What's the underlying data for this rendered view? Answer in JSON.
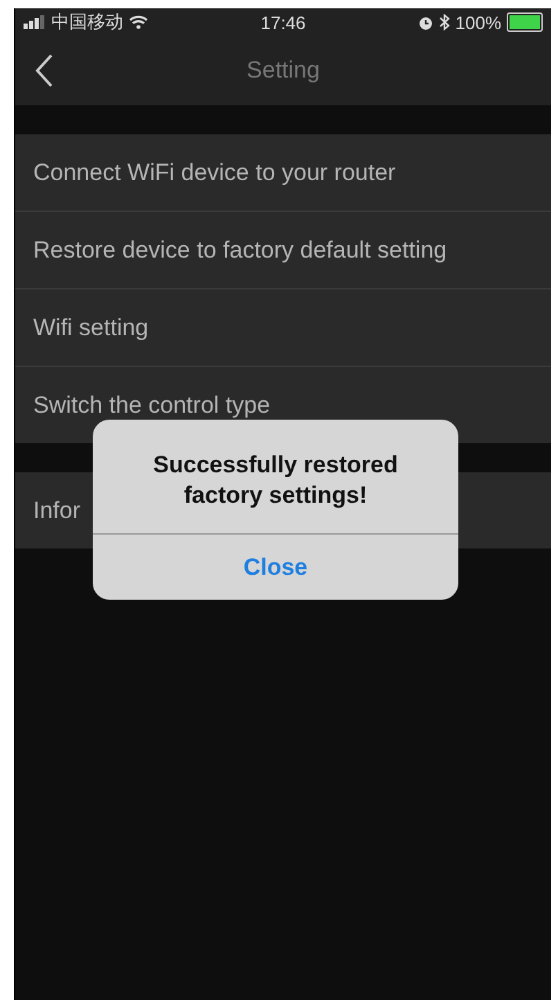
{
  "status_bar": {
    "carrier": "中国移动",
    "time": "17:46",
    "battery_text": "100%",
    "battery": {
      "level": 1.0
    }
  },
  "nav": {
    "title": "Setting"
  },
  "sections": [
    {
      "items": [
        "Connect WiFi device to your router",
        "Restore device to factory default setting",
        "Wifi setting",
        "Switch the control type"
      ]
    },
    {
      "items": [
        "Infor"
      ]
    }
  ],
  "dialog": {
    "message": "Successfully restored factory settings!",
    "button": "Close"
  }
}
